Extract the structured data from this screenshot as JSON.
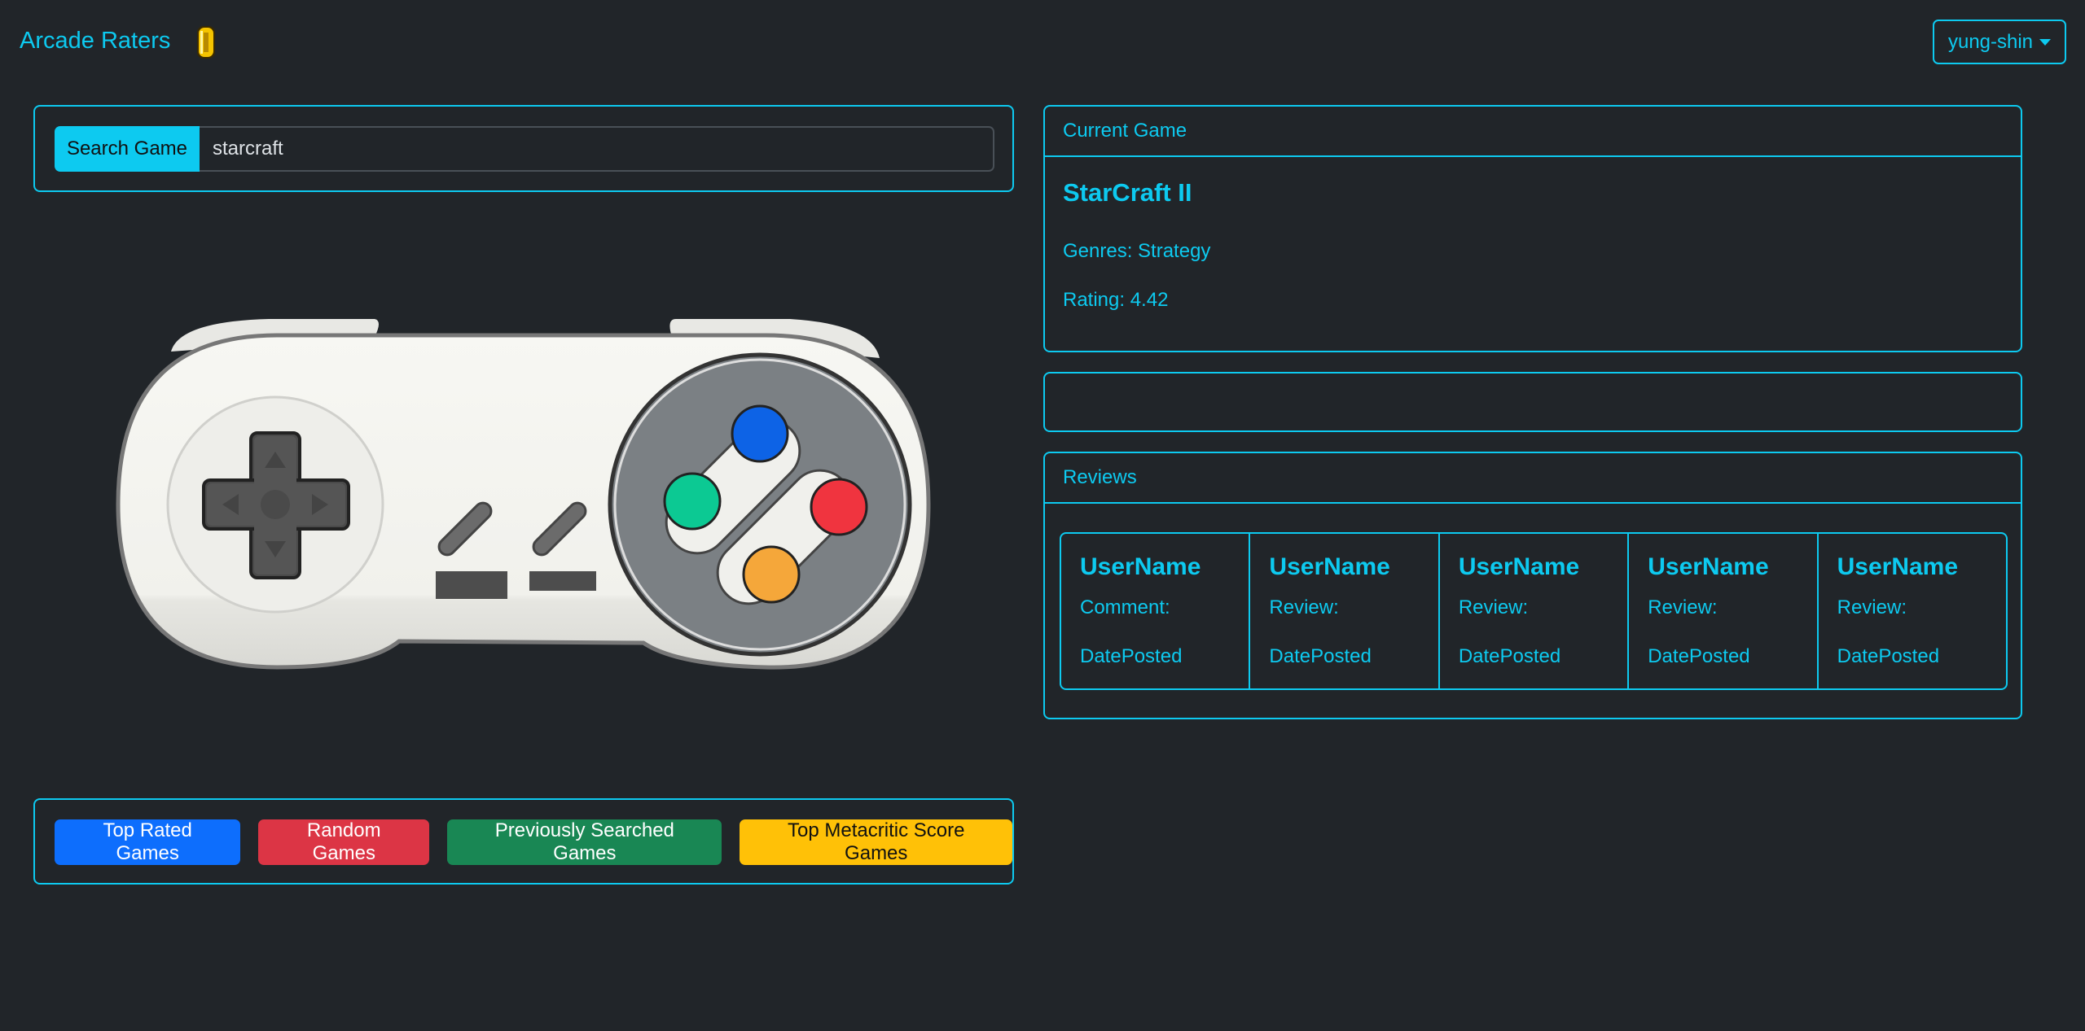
{
  "navbar": {
    "brand": "Arcade Raters",
    "user_menu": "yung-shin"
  },
  "search": {
    "button_label": "Search Game",
    "input_value": "starcraft"
  },
  "action_buttons": {
    "top_rated": "Top Rated Games",
    "random": "Random Games",
    "previously_searched": "Previously Searched Games",
    "top_metacritic": "Top Metacritic Score Games"
  },
  "current_game": {
    "header": "Current Game",
    "title": "StarCraft II",
    "genres": "Genres: Strategy",
    "rating": "Rating: 4.42"
  },
  "reviews": {
    "header": "Reviews",
    "items": [
      {
        "user": "UserName",
        "text": "Comment:",
        "date": "DatePosted"
      },
      {
        "user": "UserName",
        "text": "Review:",
        "date": "DatePosted"
      },
      {
        "user": "UserName",
        "text": "Review:",
        "date": "DatePosted"
      },
      {
        "user": "UserName",
        "text": "Review:",
        "date": "DatePosted"
      },
      {
        "user": "UserName",
        "text": "Review:",
        "date": "DatePosted"
      }
    ]
  },
  "colors": {
    "accent": "#0dcaf0",
    "background": "#212529",
    "primary": "#0d6efd",
    "danger": "#dc3545",
    "success": "#198754",
    "warning": "#ffc107"
  },
  "icons": {
    "brand_icon": "gold-coin-icon",
    "hero_image": "game-controller-icon",
    "dropdown": "caret-down-icon"
  }
}
